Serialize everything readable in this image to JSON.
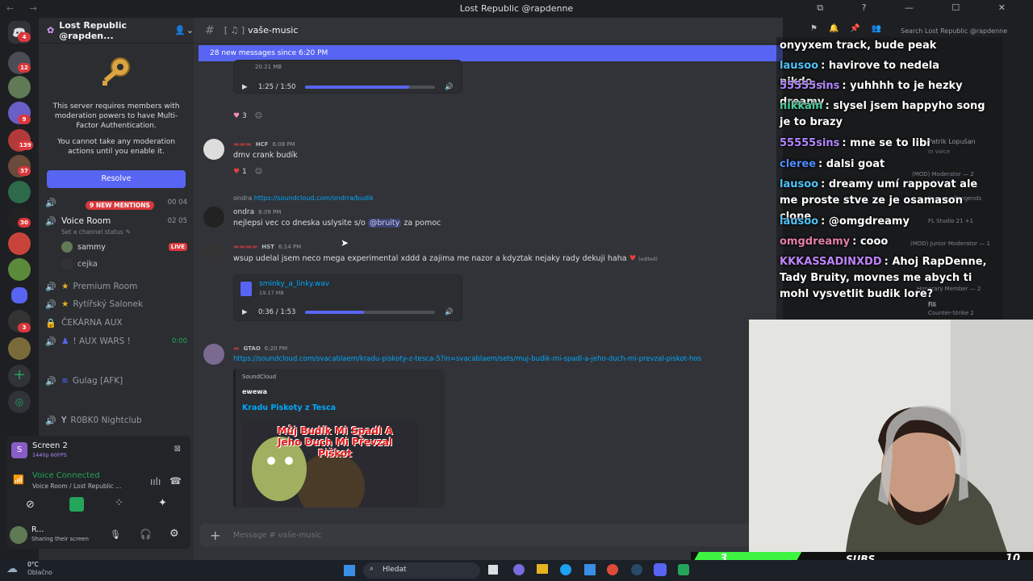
{
  "window": {
    "title": "Lost Republic @rapdenne"
  },
  "sidebar": {
    "guild_name": "Lost Republic @rapden...",
    "mfa_text_1": "This server requires members with moderation powers to have Multi-Factor Authentication.",
    "mfa_text_2": "You cannot take any moderation actions until you enable it.",
    "resolve_label": "Resolve",
    "new_mentions": "9 NEW MENTIONS",
    "voice_room": "Voice Room",
    "voice_room_count": "02 05",
    "prev_room_count": "00 04",
    "channel_status": "Set a channel status",
    "users": [
      {
        "name": "sammy",
        "live": "LIVE"
      },
      {
        "name": "cejka"
      }
    ],
    "channels": [
      {
        "label": "Premium Room"
      },
      {
        "label": "Rytířský Salonek"
      },
      {
        "label": "ČEKÁRNA AUX"
      },
      {
        "label": "! AUX WARS !",
        "timer": "0:00"
      },
      {
        "label": "Gulag [AFK]"
      },
      {
        "label": "R0BK0 Nightclub"
      }
    ],
    "screen_title": "Screen 2",
    "screen_sub": "1440p 60FPS",
    "voice_status": "Voice Connected",
    "voice_location": "Voice Room / Lost Republic ...",
    "user_name": "R...",
    "user_status": "Sharing their screen"
  },
  "chat": {
    "channel_name": "vaše-music",
    "new_messages_bar": "28 new messages since 6:20 PM",
    "msg0": {
      "file_size": "20.21 MB",
      "time": "1:25 / 1:50",
      "progress": 0.8,
      "reaction": "3"
    },
    "msg1": {
      "tag": "HCF",
      "time": "6:08 PM",
      "text": "dmv crank budík",
      "reaction": "1"
    },
    "msg2": {
      "reply_name": "ondra",
      "reply_link": "https://soundcloud.com/ondrra/budik",
      "name": "ondra",
      "time": "6:09 PM",
      "text_a": "nejlepsi vec co dneska uslysite s/o",
      "mention": "@bruity",
      "text_b": "za pomoc"
    },
    "msg3": {
      "tag": "HST",
      "time": "6:14 PM",
      "text": "wsup udelal jsem neco mega experimental xddd a zajima me nazor a kdyztak nejaky rady dekuji haha",
      "edited": "(edited)",
      "file_name": "sminky_a_linky.wav",
      "file_size": "19.17 MB",
      "audio_time": "0:36 / 1:53",
      "progress": 0.45
    },
    "msg4": {
      "tag": "GTAO",
      "time": "6:20 PM",
      "link": "https://soundcloud.com/svacablaem/kradu-piskoty-z-tesca-5?in=svacablaem/sets/muj-budik-mi-spadl-a-jeho-duch-mi-prevzal-piskot-hos",
      "embed_provider": "SoundCloud",
      "embed_author": "ewewa",
      "embed_title": "Kradu Piskoty z Tesca",
      "art_text": "Můj Budík Mi Spadl A Jeho Duch Mi Převzal Piškot"
    },
    "composer_placeholder": "Message #  vaše-music"
  },
  "header": {
    "search_placeholder": "Search Lost Republic @rapdenne"
  },
  "overlay_chat": [
    {
      "user": "",
      "text": "onyyxem track, bude peak",
      "color": "#ffffff"
    },
    {
      "user": "lausoo",
      "text": ": havirove to nedela nikdo...",
      "color": "#4fc3f7"
    },
    {
      "user": "55555sins",
      "text": ": yuhhhh to je hezky dreamy",
      "color": "#b388ff"
    },
    {
      "user": "nikkain",
      "text": ": slysel jsem happyho song je to brazy",
      "color": "#4dd0a0"
    },
    {
      "user": "55555sins",
      "text": ": mne se to libi",
      "color": "#b388ff"
    },
    {
      "user": "cleree",
      "text": ": dalsi goat",
      "color": "#4f8dff"
    },
    {
      "user": "lausoo",
      "text": ": dreamy umí rappovat ale me proste stve ze je osamason clone",
      "color": "#4fc3f7"
    },
    {
      "user": "lausoo",
      "text": ": @omgdreamy",
      "color": "#4fc3f7"
    },
    {
      "user": "omgdreamy",
      "text": ": cooo",
      "color": "#e580a8"
    },
    {
      "user": "KKKASSADINXDD",
      "text": ": Ahoj RapDenne, Tady Bruity, movnes me abych ti mohl vysvetlit budik lore?",
      "color": "#c084fc"
    }
  ],
  "members_faint": [
    "Patrik Lopušan",
    "In voice",
    "(MOD) Moderator — 2",
    "League of Legends",
    "FL Studio 21 +1",
    "(MOD) Junior Moderator — 1",
    "Honorary Member — 2",
    "Fili",
    "Counter-Strike 2"
  ],
  "subs_bar": {
    "left": "3",
    "center": "SUBS",
    "right": "10",
    "fill": 0.3
  },
  "taskbar": {
    "weather_temp": "0°C",
    "weather_desc": "Oblačno",
    "search": "Hledat"
  },
  "colors": {
    "accent": "#5865f2",
    "danger": "#da373c",
    "green": "#23a55a",
    "subs_green": "#3df541"
  }
}
